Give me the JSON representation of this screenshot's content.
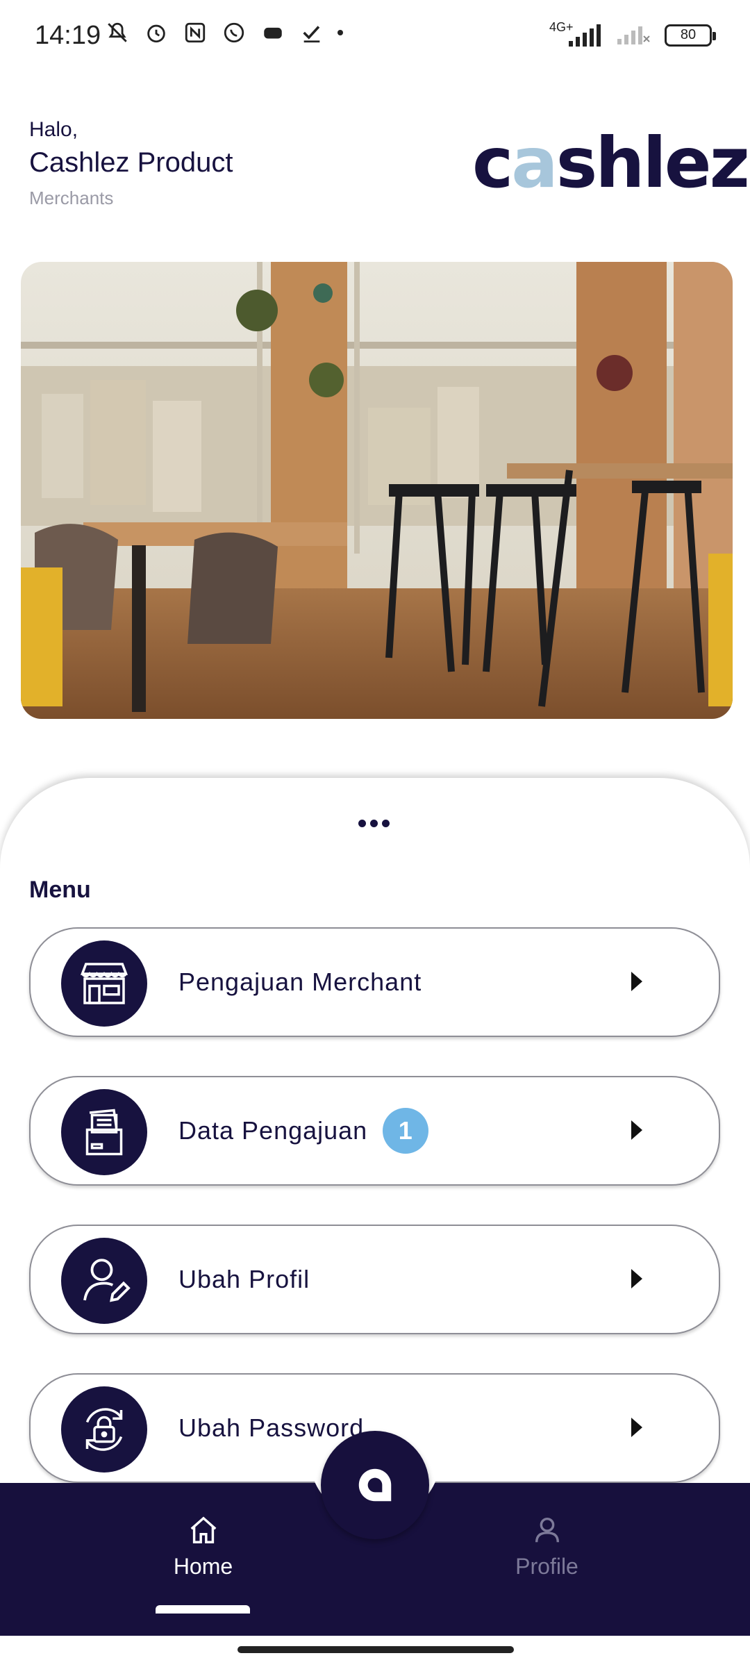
{
  "status_bar": {
    "time": "14:19",
    "network": "4G+",
    "battery": "80"
  },
  "header": {
    "greeting": "Halo,",
    "user_name": "Cashlez Product",
    "user_role": "Merchants",
    "logo_text_start": "c",
    "logo_text_o": "a",
    "logo_text_end": "shlez"
  },
  "hero": {
    "image": "cafe interior photo"
  },
  "menu": {
    "title": "Menu",
    "items": [
      {
        "label": "Pengajuan Merchant",
        "icon": "store-icon",
        "badge": ""
      },
      {
        "label": "Data Pengajuan",
        "icon": "document-folder-icon",
        "badge": "1"
      },
      {
        "label": "Ubah Profil",
        "icon": "user-edit-icon",
        "badge": ""
      },
      {
        "label": "Ubah Password",
        "icon": "lock-refresh-icon",
        "badge": ""
      }
    ]
  },
  "bottom_nav": {
    "home_label": "Home",
    "profile_label": "Profile",
    "active": "home"
  },
  "colors": {
    "brand_dark": "#17123f",
    "brand_light": "#a7c6db",
    "badge": "#6fb6e6"
  }
}
